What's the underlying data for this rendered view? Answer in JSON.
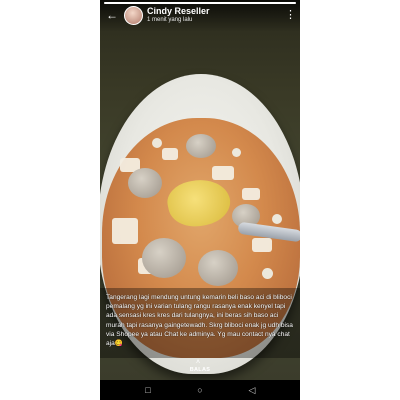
{
  "story": {
    "progress": 1.0,
    "user_name": "Cindy Reseller",
    "posted_time": "1 menit yang lalu",
    "caption": "Tangerang lagi mendung untung kemarin beli baso aci di bliboci pemalang yg ini varian tulang rangu rasanya enak kenyel tapi ada sensasi kres kres dari tulangnya, ini beras sih baso aci murah tapi rasanya gaingetewadh. Skrg bliboci enak jg udh bisa via Shopee ya atau Chat ke adminya. Yg mau contact nya chat aja😋",
    "reply_label": "BALAS"
  },
  "icons": {
    "back": "back-arrow-icon",
    "menu": "more-vert-icon",
    "reply": "chevron-up-icon",
    "nav_recents": "square-icon",
    "nav_home": "circle-icon",
    "nav_back": "triangle-back-icon"
  },
  "colors": {
    "header_text": "#ffffff",
    "navbar": "#000000"
  }
}
